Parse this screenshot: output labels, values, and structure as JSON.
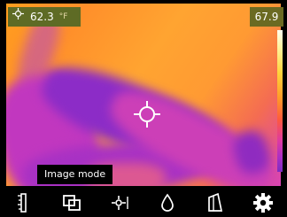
{
  "readouts": {
    "spot_temperature": "62.3",
    "spot_unit": "°F",
    "scale_max": "67.9"
  },
  "tooltip": {
    "label": "Image mode"
  },
  "toolbar": {
    "items": [
      {
        "icon": "thermometer-scale-icon"
      },
      {
        "icon": "image-mode-icon"
      },
      {
        "icon": "spot-crosshair-icon"
      },
      {
        "icon": "emissivity-drop-icon"
      },
      {
        "icon": "palette-icon"
      },
      {
        "icon": "gear-icon"
      }
    ]
  },
  "colors": {
    "readout_background": "#5e6b25",
    "toolbar_background": "#000000",
    "icon_color": "#ffffff"
  }
}
